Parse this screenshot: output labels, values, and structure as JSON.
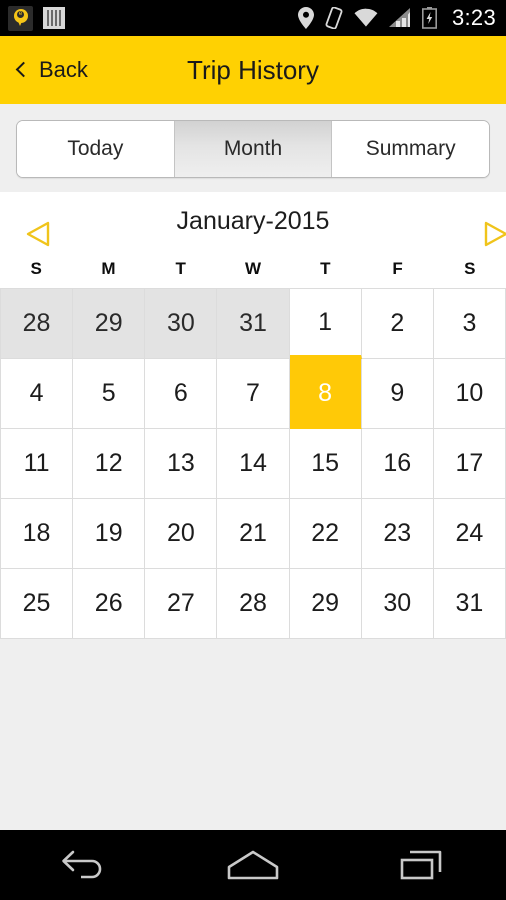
{
  "statusbar": {
    "time": "3:23",
    "left_icons": [
      {
        "name": "ezpass-app-icon",
        "glyph": "e"
      },
      {
        "name": "barcode-icon",
        "glyph": "||||"
      }
    ],
    "right_icons": [
      "location-pin-icon",
      "vibrate-icon",
      "wifi-icon",
      "signal-icon",
      "battery-charging-icon"
    ]
  },
  "header": {
    "back_label": "Back",
    "title": "Trip History",
    "background": "#ffd102"
  },
  "tabs": {
    "items": [
      {
        "label": "Today",
        "active": false
      },
      {
        "label": "Month",
        "active": true
      },
      {
        "label": "Summary",
        "active": false
      }
    ]
  },
  "month_nav": {
    "prev_label": "◁",
    "next_label": "▷",
    "current_month": "January-2015"
  },
  "calendar": {
    "weekdays": [
      "S",
      "M",
      "T",
      "W",
      "T",
      "F",
      "S"
    ],
    "accent_color": "#ffc907",
    "weeks": [
      [
        {
          "day": "28",
          "state": "other"
        },
        {
          "day": "29",
          "state": "other"
        },
        {
          "day": "30",
          "state": "other"
        },
        {
          "day": "31",
          "state": "other"
        },
        {
          "day": "1",
          "state": "underline"
        },
        {
          "day": "2",
          "state": "normal"
        },
        {
          "day": "3",
          "state": "normal"
        }
      ],
      [
        {
          "day": "4",
          "state": "normal"
        },
        {
          "day": "5",
          "state": "normal"
        },
        {
          "day": "6",
          "state": "normal"
        },
        {
          "day": "7",
          "state": "normal"
        },
        {
          "day": "8",
          "state": "selected"
        },
        {
          "day": "9",
          "state": "normal"
        },
        {
          "day": "10",
          "state": "normal"
        }
      ],
      [
        {
          "day": "11",
          "state": "normal"
        },
        {
          "day": "12",
          "state": "normal"
        },
        {
          "day": "13",
          "state": "normal"
        },
        {
          "day": "14",
          "state": "normal"
        },
        {
          "day": "15",
          "state": "normal"
        },
        {
          "day": "16",
          "state": "normal"
        },
        {
          "day": "17",
          "state": "normal"
        }
      ],
      [
        {
          "day": "18",
          "state": "normal"
        },
        {
          "day": "19",
          "state": "normal"
        },
        {
          "day": "20",
          "state": "normal"
        },
        {
          "day": "21",
          "state": "normal"
        },
        {
          "day": "22",
          "state": "normal"
        },
        {
          "day": "23",
          "state": "normal"
        },
        {
          "day": "24",
          "state": "normal"
        }
      ],
      [
        {
          "day": "25",
          "state": "normal"
        },
        {
          "day": "26",
          "state": "normal"
        },
        {
          "day": "27",
          "state": "normal"
        },
        {
          "day": "28",
          "state": "normal"
        },
        {
          "day": "29",
          "state": "normal"
        },
        {
          "day": "30",
          "state": "normal"
        },
        {
          "day": "31",
          "state": "normal"
        }
      ]
    ]
  },
  "navbar": {
    "buttons": [
      "back-nav-icon",
      "home-nav-icon",
      "recents-nav-icon"
    ]
  }
}
